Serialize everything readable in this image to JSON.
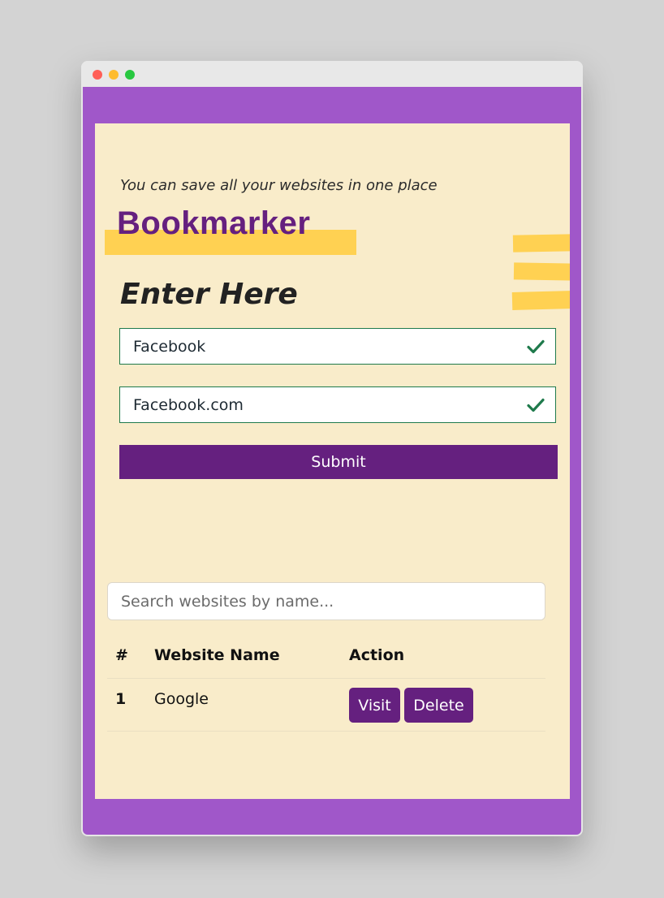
{
  "app": {
    "tagline": "You can save all your websites in one place",
    "brand": "Bookmarker"
  },
  "colors": {
    "frame": "#a057c9",
    "content_bg": "#f9ecca",
    "brand_purple": "#65207f",
    "highlight_yellow": "#ffd152",
    "valid_green": "#1f7a4c"
  },
  "form": {
    "heading": "Enter Here",
    "name_field": {
      "value": "Facebook",
      "status_icon": "check-icon"
    },
    "url_field": {
      "value": "Facebook.com",
      "status_icon": "check-icon"
    },
    "submit_label": "Submit"
  },
  "search": {
    "placeholder": "Search websites by name..."
  },
  "table": {
    "headers": [
      "#",
      "Website Name",
      "Action"
    ],
    "rows": [
      {
        "index": "1",
        "name": "Google",
        "visit_label": "Visit",
        "delete_label": "Delete"
      }
    ]
  }
}
